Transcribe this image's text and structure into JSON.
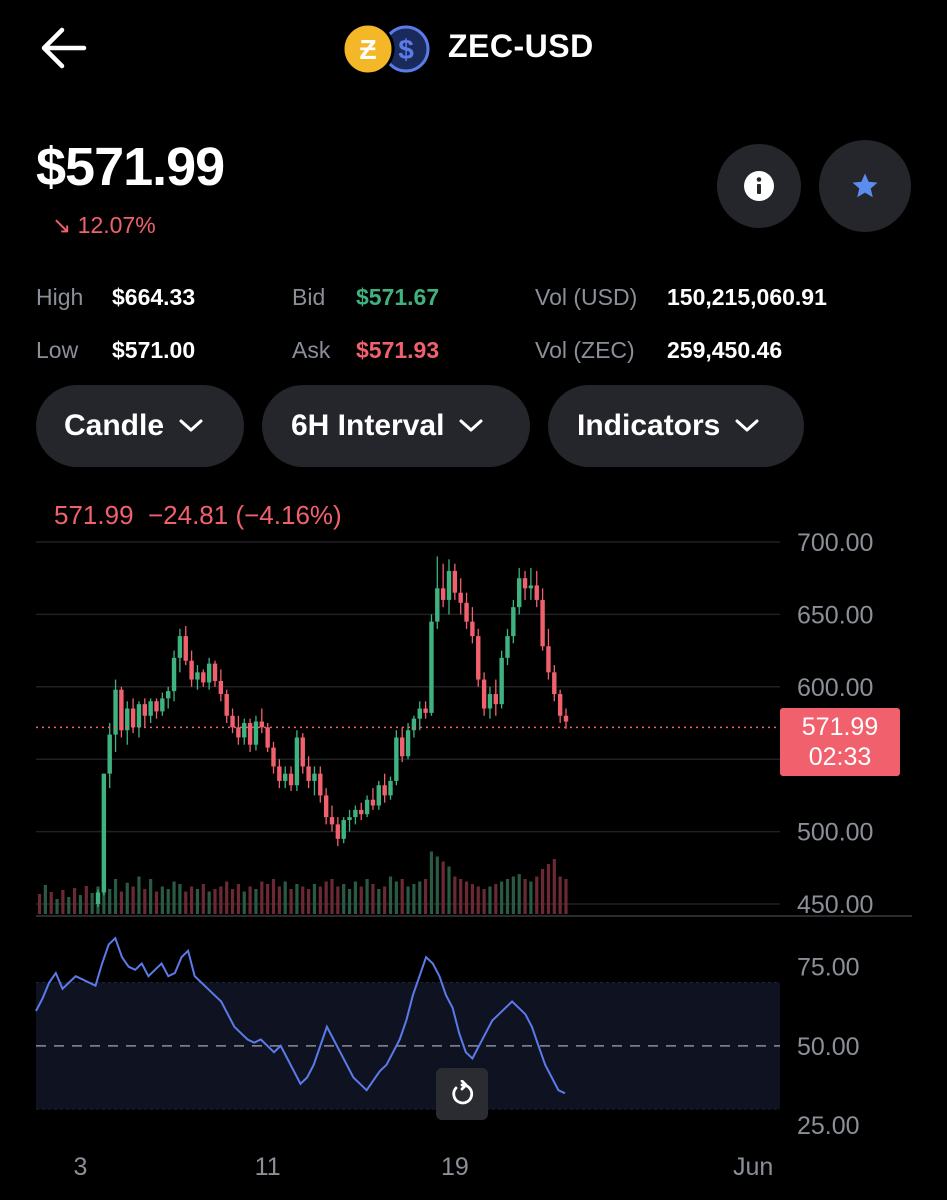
{
  "header": {
    "pair": "ZEC-USD",
    "coin_a_symbol": "Ƶ",
    "coin_b_symbol": "$",
    "icons": [
      "back-arrow-icon",
      "zcash-coin-icon",
      "usd-coin-icon",
      "info-icon",
      "star-icon",
      "chevron-down-icon",
      "reset-icon"
    ]
  },
  "price": {
    "value": "$571.99",
    "change_arrow": "↘",
    "change": "12.07%"
  },
  "stats": {
    "high_label": "High",
    "high_value": "$664.33",
    "low_label": "Low",
    "low_value": "$571.00",
    "bid_label": "Bid",
    "bid_value": "$571.67",
    "ask_label": "Ask",
    "ask_value": "$571.93",
    "vol_usd_label": "Vol (USD)",
    "vol_usd_value": "150,215,060.91",
    "vol_zec_label": "Vol (ZEC)",
    "vol_zec_value": "259,450.46"
  },
  "controls": {
    "chart_type": "Candle",
    "interval": "6H Interval",
    "indicators": "Indicators"
  },
  "ohlc_header": {
    "last": "571.99",
    "change": "−24.81",
    "change_pct": "(−4.16%)"
  },
  "price_badge": {
    "price": "571.99",
    "countdown": "02:33"
  },
  "colors": {
    "up": "#3fb27f",
    "down": "#f0616d",
    "rsi": "#5b7bea",
    "accent_star": "#5b8def",
    "zec": "#f4b728"
  },
  "chart_data": {
    "type": "candlestick",
    "price_axis_ticks": [
      "700.00",
      "650.00",
      "600.00",
      "500.00",
      "450.00"
    ],
    "price_ylim": [
      450,
      700
    ],
    "last_price": 571.99,
    "x_ticks": [
      "3",
      "11",
      "19",
      "Jun"
    ],
    "x_tick_index": [
      -3,
      29,
      61,
      112
    ],
    "interval": "6H",
    "candles": [
      [
        450,
        460,
        448,
        458
      ],
      [
        458,
        540,
        456,
        540
      ],
      [
        540,
        575,
        530,
        567
      ],
      [
        567,
        605,
        555,
        598
      ],
      [
        598,
        600,
        565,
        570
      ],
      [
        570,
        590,
        560,
        585
      ],
      [
        585,
        592,
        568,
        572
      ],
      [
        572,
        590,
        565,
        588
      ],
      [
        588,
        592,
        572,
        580
      ],
      [
        580,
        592,
        575,
        590
      ],
      [
        590,
        592,
        578,
        583
      ],
      [
        583,
        596,
        580,
        592
      ],
      [
        592,
        600,
        585,
        597
      ],
      [
        597,
        625,
        590,
        620
      ],
      [
        620,
        640,
        610,
        635
      ],
      [
        635,
        642,
        615,
        618
      ],
      [
        618,
        625,
        600,
        605
      ],
      [
        605,
        615,
        598,
        610
      ],
      [
        610,
        612,
        600,
        603
      ],
      [
        603,
        620,
        598,
        616
      ],
      [
        616,
        618,
        600,
        604
      ],
      [
        604,
        612,
        590,
        595
      ],
      [
        595,
        598,
        575,
        580
      ],
      [
        580,
        585,
        568,
        572
      ],
      [
        572,
        580,
        560,
        565
      ],
      [
        565,
        578,
        560,
        575
      ],
      [
        575,
        578,
        555,
        560
      ],
      [
        560,
        580,
        556,
        576
      ],
      [
        576,
        585,
        568,
        572
      ],
      [
        572,
        575,
        555,
        558
      ],
      [
        558,
        562,
        540,
        545
      ],
      [
        545,
        550,
        530,
        535
      ],
      [
        535,
        545,
        530,
        540
      ],
      [
        540,
        545,
        528,
        532
      ],
      [
        532,
        570,
        528,
        565
      ],
      [
        565,
        568,
        540,
        545
      ],
      [
        545,
        552,
        530,
        535
      ],
      [
        535,
        545,
        525,
        540
      ],
      [
        540,
        545,
        520,
        525
      ],
      [
        525,
        530,
        505,
        510
      ],
      [
        510,
        518,
        500,
        505
      ],
      [
        505,
        510,
        490,
        495
      ],
      [
        495,
        510,
        492,
        508
      ],
      [
        508,
        515,
        500,
        510
      ],
      [
        510,
        518,
        505,
        515
      ],
      [
        515,
        520,
        508,
        512
      ],
      [
        512,
        525,
        510,
        522
      ],
      [
        522,
        530,
        515,
        518
      ],
      [
        518,
        535,
        515,
        532
      ],
      [
        532,
        540,
        520,
        525
      ],
      [
        525,
        538,
        522,
        535
      ],
      [
        535,
        570,
        532,
        565
      ],
      [
        565,
        572,
        548,
        552
      ],
      [
        552,
        575,
        550,
        570
      ],
      [
        570,
        580,
        565,
        578
      ],
      [
        578,
        590,
        570,
        585
      ],
      [
        585,
        590,
        578,
        582
      ],
      [
        582,
        650,
        580,
        645
      ],
      [
        645,
        690,
        640,
        668
      ],
      [
        668,
        685,
        655,
        660
      ],
      [
        660,
        688,
        650,
        680
      ],
      [
        680,
        685,
        660,
        665
      ],
      [
        665,
        675,
        650,
        658
      ],
      [
        658,
        665,
        640,
        645
      ],
      [
        645,
        655,
        630,
        635
      ],
      [
        635,
        640,
        600,
        605
      ],
      [
        605,
        610,
        580,
        585
      ],
      [
        585,
        600,
        578,
        595
      ],
      [
        595,
        605,
        580,
        588
      ],
      [
        588,
        625,
        585,
        620
      ],
      [
        620,
        640,
        615,
        635
      ],
      [
        635,
        660,
        630,
        655
      ],
      [
        655,
        682,
        650,
        675
      ],
      [
        675,
        680,
        660,
        668
      ],
      [
        668,
        682,
        660,
        670
      ],
      [
        670,
        680,
        655,
        660
      ],
      [
        660,
        668,
        625,
        628
      ],
      [
        628,
        640,
        605,
        610
      ],
      [
        610,
        615,
        590,
        595
      ],
      [
        595,
        598,
        575,
        580
      ],
      [
        580,
        585,
        571,
        576
      ]
    ],
    "volume": [
      22,
      25,
      20,
      28,
      18,
      25,
      22,
      30,
      20,
      28,
      18,
      22,
      20,
      26,
      24,
      18,
      22,
      20,
      24,
      18,
      20,
      22,
      26,
      20,
      24,
      18,
      22,
      20,
      26,
      24,
      28,
      22,
      26,
      20,
      24,
      22,
      20,
      24,
      22,
      26,
      28,
      22,
      24,
      20,
      26,
      22,
      28,
      24,
      20,
      22,
      30,
      26,
      28,
      22,
      24,
      26,
      28,
      50,
      46,
      42,
      38,
      30,
      28,
      26,
      24,
      22,
      20,
      22,
      24,
      26,
      28,
      30,
      32,
      28,
      26,
      30,
      36,
      40,
      44,
      30,
      28
    ],
    "rsi": {
      "ticks": [
        "75.00",
        "50.00",
        "25.00"
      ],
      "ylim": [
        25,
        85
      ],
      "midline": 50,
      "band": [
        30,
        70
      ],
      "values": [
        61,
        65,
        70,
        73,
        68,
        70,
        72,
        71,
        70,
        69,
        76,
        82,
        84,
        78,
        75,
        74,
        76,
        72,
        74,
        76,
        72,
        73,
        78,
        80,
        72,
        70,
        68,
        66,
        64,
        60,
        56,
        54,
        52,
        51,
        52,
        50,
        48,
        50,
        46,
        42,
        38,
        40,
        44,
        50,
        56,
        52,
        48,
        44,
        40,
        38,
        36,
        39,
        42,
        44,
        48,
        52,
        58,
        66,
        72,
        78,
        76,
        72,
        66,
        62,
        54,
        48,
        46,
        50,
        54,
        58,
        60,
        62,
        64,
        62,
        60,
        56,
        50,
        44,
        40,
        36,
        35
      ]
    }
  }
}
